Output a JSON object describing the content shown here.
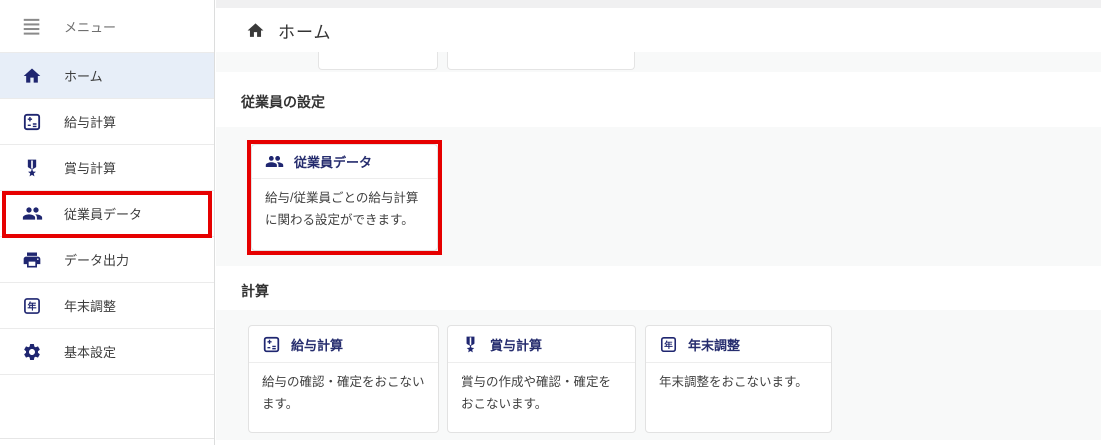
{
  "app": {
    "annotation_color": "#e60000",
    "accent_navy": "#1f2670",
    "active_item_bg": "#e7eef8"
  },
  "sidebar": {
    "items": [
      {
        "label": "メニュー",
        "icon": "menu-icon"
      },
      {
        "label": "ホーム",
        "icon": "home-icon",
        "active": true
      },
      {
        "label": "給与計算",
        "icon": "calculator-icon"
      },
      {
        "label": "賞与計算",
        "icon": "medal-icon"
      },
      {
        "label": "従業員データ",
        "icon": "people-icon",
        "highlighted": true
      },
      {
        "label": "データ出力",
        "icon": "printer-icon"
      },
      {
        "label": "年末調整",
        "icon": "year-icon"
      },
      {
        "label": "基本設定",
        "icon": "gear-icon"
      }
    ]
  },
  "header": {
    "title": "ホーム",
    "icon": "home-icon"
  },
  "sections": [
    {
      "title": "従業員の設定",
      "cards": [
        {
          "title": "従業員データ",
          "icon": "people-icon",
          "description": "給与/従業員ごとの給与計算に関わる設定ができます。",
          "highlighted": true
        }
      ]
    },
    {
      "title": "計算",
      "cards": [
        {
          "title": "給与計算",
          "icon": "calculator-icon",
          "description": "給与の確認・確定をおこないます。"
        },
        {
          "title": "賞与計算",
          "icon": "medal-icon",
          "description": "賞与の作成や確認・確定をおこないます。"
        },
        {
          "title": "年末調整",
          "icon": "year-icon",
          "description": "年末調整をおこないます。"
        }
      ]
    }
  ],
  "icons": {
    "year_char": "年"
  }
}
